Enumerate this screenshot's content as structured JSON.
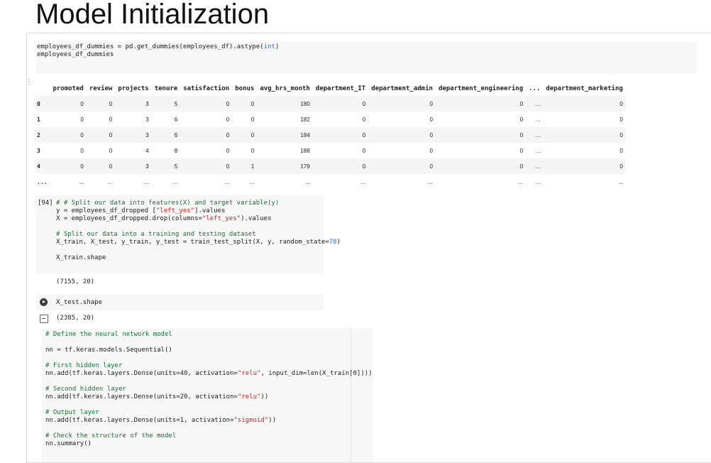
{
  "page_title": "Model Initialization",
  "cell1": {
    "line1_a": "employees_df_dummies = pd.get_dummies(employees_df).astype(",
    "line1_b": "int",
    "line1_c": ")",
    "line2": "employees_df_dummies"
  },
  "table": {
    "columns": [
      "promoted",
      "review",
      "projects",
      "tenure",
      "satisfaction",
      "bonus",
      "avg_hrs_month",
      "department_IT",
      "department_admin",
      "department_engineering",
      "...",
      "department_marketing"
    ],
    "rows": [
      {
        "index": "0",
        "values": [
          "0",
          "0",
          "3",
          "5",
          "0",
          "0",
          "180",
          "0",
          "0",
          "0",
          "...",
          "0"
        ]
      },
      {
        "index": "1",
        "values": [
          "0",
          "0",
          "3",
          "6",
          "0",
          "0",
          "182",
          "0",
          "0",
          "0",
          "...",
          "0"
        ]
      },
      {
        "index": "2",
        "values": [
          "0",
          "0",
          "3",
          "6",
          "0",
          "0",
          "184",
          "0",
          "0",
          "0",
          "...",
          "0"
        ]
      },
      {
        "index": "3",
        "values": [
          "0",
          "0",
          "4",
          "8",
          "0",
          "0",
          "188",
          "0",
          "0",
          "0",
          "...",
          "0"
        ]
      },
      {
        "index": "4",
        "values": [
          "0",
          "0",
          "3",
          "5",
          "0",
          "1",
          "179",
          "0",
          "0",
          "0",
          "...",
          "0"
        ]
      },
      {
        "index": "...",
        "values": [
          "...",
          "...",
          "...",
          "...",
          "...",
          "...",
          "...",
          "...",
          "...",
          "...",
          "...",
          "..."
        ]
      }
    ]
  },
  "cell2": {
    "exec_count": "[94]",
    "comment1": "# # Split our data into features(X) and target variable(y)",
    "y_a": "y = employees_df_dropped [",
    "y_str": "\"left_yes\"",
    "y_b": "].values",
    "x_a": "X = employees_df_dropped.drop(columns=",
    "x_str": "\"left_yes\"",
    "x_b": ").values",
    "comment2": "# Split our data into a training and testing dataset",
    "split_a": "X_train, X_test, y_train, y_test = train_test_split(X, y, random_state=",
    "split_num": "78",
    "split_b": ")",
    "shape": "X_train.shape",
    "output": "(7155, 20)"
  },
  "cell3": {
    "code": "X_test.shape",
    "output": "(2385, 20)"
  },
  "cell4": {
    "c_define": "# Define the neural network model",
    "seq": "nn = tf.keras.models.Sequential()",
    "c_first": "# First hidden layer",
    "first_a": "nn.add(tf.keras.layers.Dense(units=40, activation=",
    "first_str": "\"relu\"",
    "first_b": ", input_dim=len(X_train[0])))",
    "c_second": "# Second hidden layer",
    "second_a": "nn.add(tf.keras.layers.Dense(units=20, activation=",
    "second_str": "\"relu\"",
    "second_b": "))",
    "c_output": "# Output layer",
    "out_a": "nn.add(tf.keras.layers.Dense(units=1, activation=",
    "out_str": "\"sigmoid\"",
    "out_b": "))",
    "c_check": "# Check the structure of the model",
    "summary": "nn.summary()"
  },
  "colors": {
    "comment": "#137333",
    "string": "#c5221f",
    "number": "#1a73e8",
    "cell_bg": "#f7f7f7"
  }
}
